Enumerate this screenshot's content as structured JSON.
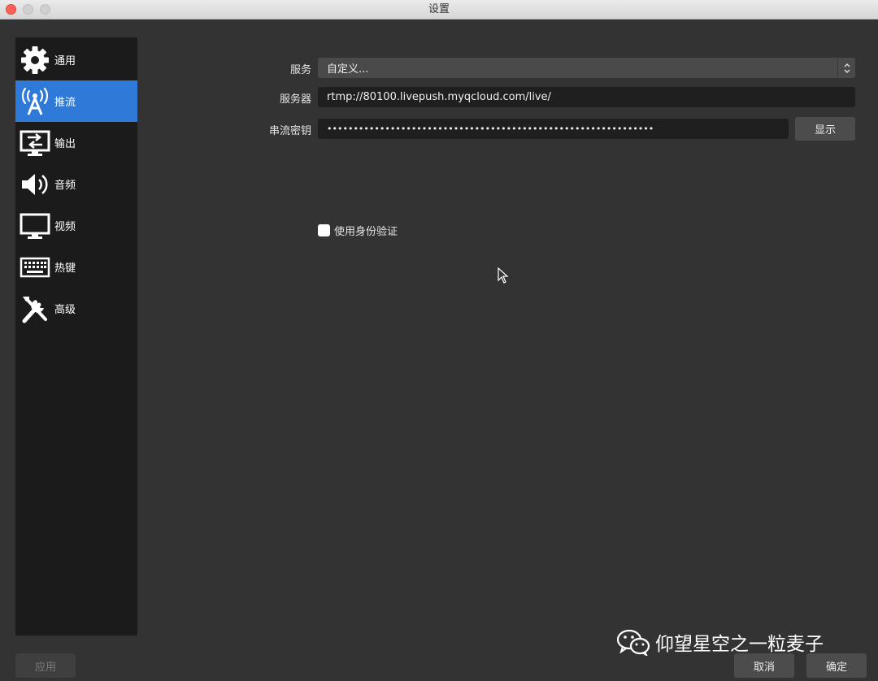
{
  "window": {
    "title": "设置"
  },
  "sidebar": {
    "items": [
      {
        "label": "通用",
        "icon": "gear-icon"
      },
      {
        "label": "推流",
        "icon": "broadcast-tower-icon",
        "selected": true
      },
      {
        "label": "输出",
        "icon": "output-icon"
      },
      {
        "label": "音频",
        "icon": "speaker-icon"
      },
      {
        "label": "视频",
        "icon": "monitor-icon"
      },
      {
        "label": "热键",
        "icon": "keyboard-icon"
      },
      {
        "label": "高级",
        "icon": "tools-icon"
      }
    ]
  },
  "stream": {
    "service_label": "服务",
    "service_value": "自定义...",
    "server_label": "服务器",
    "server_value": "rtmp://80100.livepush.myqcloud.com/live/",
    "key_label": "串流密钥",
    "key_value": "••••••••••••••••••••••••••••••••••••••••••••••••••••••••••••••",
    "show_button": "显示",
    "auth_label": "使用身份验证",
    "auth_checked": false
  },
  "footer": {
    "apply": "应用",
    "cancel": "取消",
    "ok": "确定"
  },
  "watermark": {
    "text": "仰望星空之一粒麦子"
  },
  "colors": {
    "background": "#333333",
    "sidebar": "#1b1b1b",
    "selected": "#2f7ad9",
    "input": "#1f1f1f",
    "button": "#4c4c4c"
  }
}
